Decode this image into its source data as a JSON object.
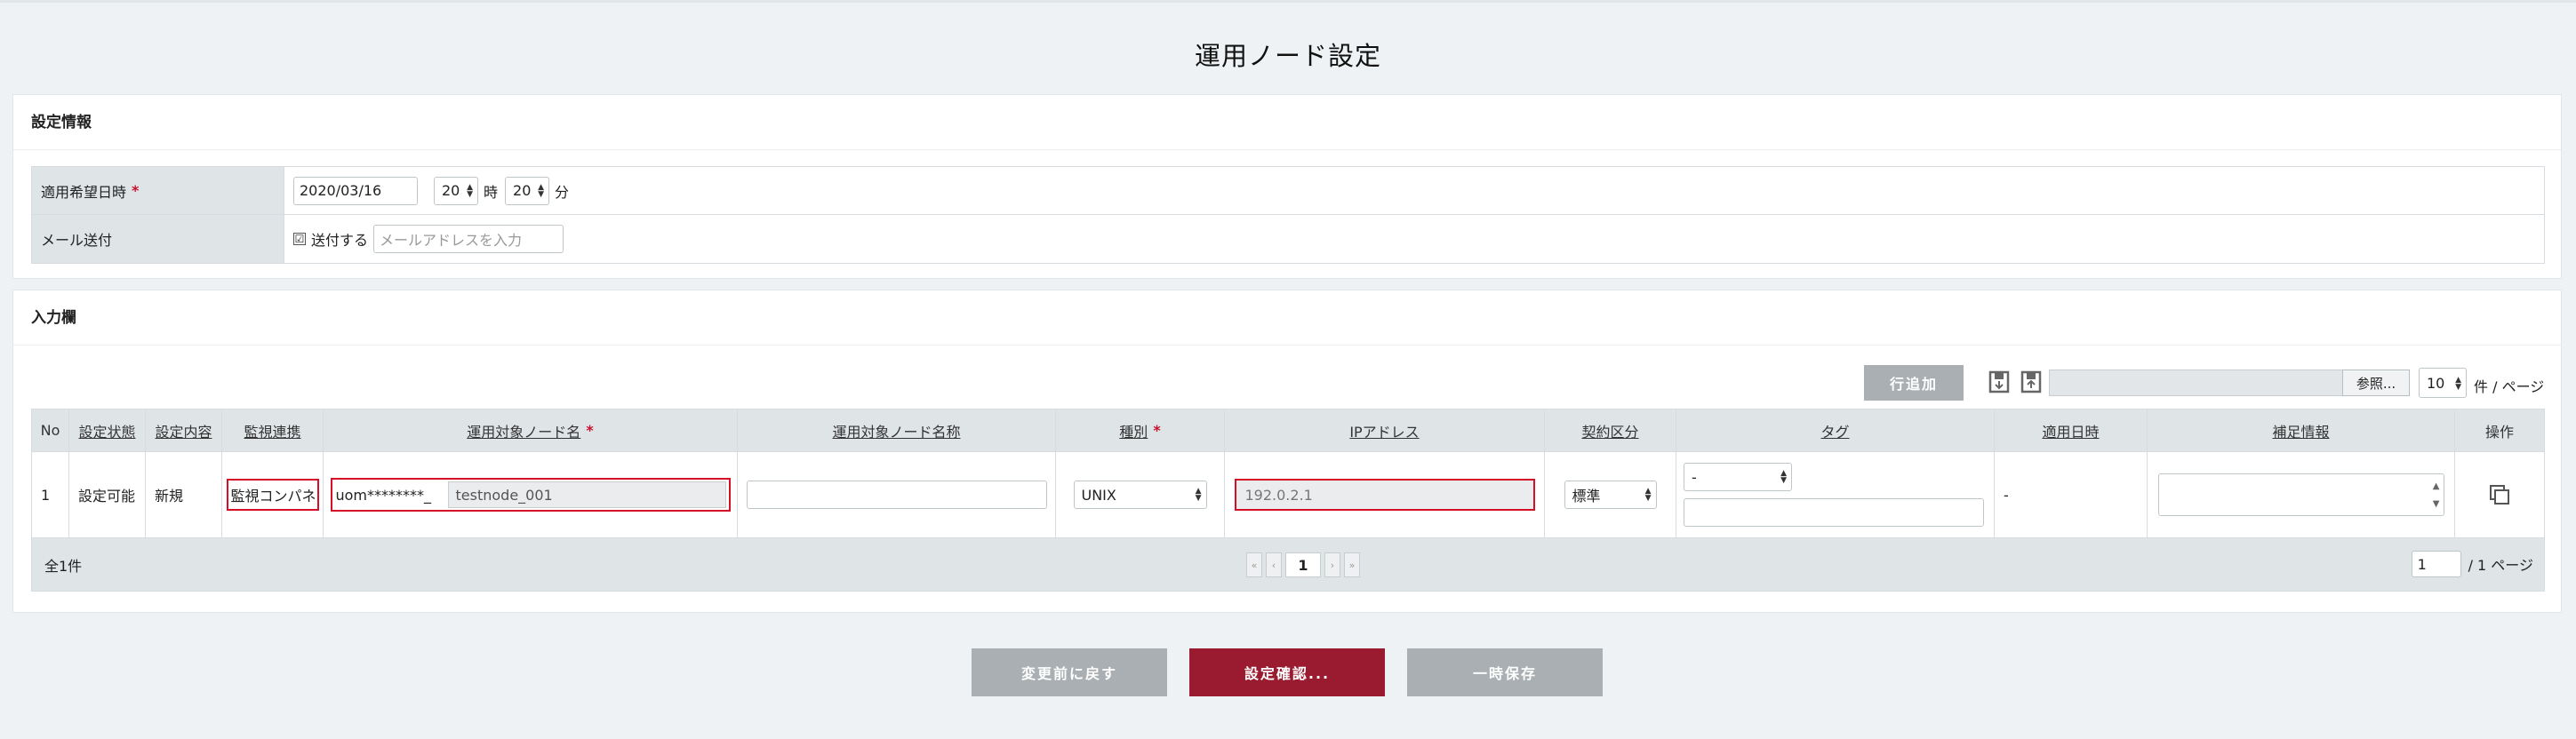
{
  "page_title": "運用ノード設定",
  "settings_panel": {
    "title": "設定情報",
    "desired_datetime": {
      "label": "適用希望日時",
      "required_mark": "*",
      "date": "2020/03/16",
      "hour": "20",
      "hour_unit": "時",
      "minute": "20",
      "minute_unit": "分"
    },
    "mail": {
      "label": "メール送付",
      "check_mark": "☑",
      "checkbox_label": "送付する",
      "checked": true,
      "address_placeholder": "メールアドレスを入力"
    }
  },
  "input_panel": {
    "title": "入力欄",
    "add_row_label": "行追加",
    "browse_label": "参照...",
    "per_page": "10",
    "per_page_unit": "件 / ページ",
    "columns": [
      {
        "label": "No",
        "sortable": false
      },
      {
        "label": "設定状態",
        "sortable": true
      },
      {
        "label": "設定内容",
        "sortable": true
      },
      {
        "label": "監視連携",
        "sortable": true
      },
      {
        "label": "運用対象ノード名",
        "sortable": true,
        "required": true
      },
      {
        "label": "運用対象ノード名称",
        "sortable": true
      },
      {
        "label": "種別",
        "sortable": true,
        "required": true
      },
      {
        "label": "IPアドレス",
        "sortable": true
      },
      {
        "label": "契約区分",
        "sortable": true
      },
      {
        "label": "タグ",
        "sortable": true
      },
      {
        "label": "適用日時",
        "sortable": true
      },
      {
        "label": "補足情報",
        "sortable": true
      },
      {
        "label": "操作",
        "sortable": false
      }
    ],
    "required_mark": "*",
    "rows": [
      {
        "no": "1",
        "status": "設定可能",
        "content": "新規",
        "monitoring": "監視コンパネ",
        "node_prefix": "uom********_",
        "node_name": "testnode_001",
        "node_label": "",
        "kind": "UNIX",
        "ip": "192.0.2.1",
        "contract": "標準",
        "tag": "-",
        "apply_datetime": "-"
      }
    ],
    "total_label": "全1件",
    "current_page": "1",
    "page_input": "1",
    "page_total": "/  1 ページ"
  },
  "buttons": {
    "revert": "変更前に戻す",
    "confirm": "設定確認...",
    "save_draft": "一時保存"
  },
  "colors": {
    "accent_red": "#9a1b2f",
    "highlight": "#d40f27",
    "gray_button": "#a9afb2"
  }
}
